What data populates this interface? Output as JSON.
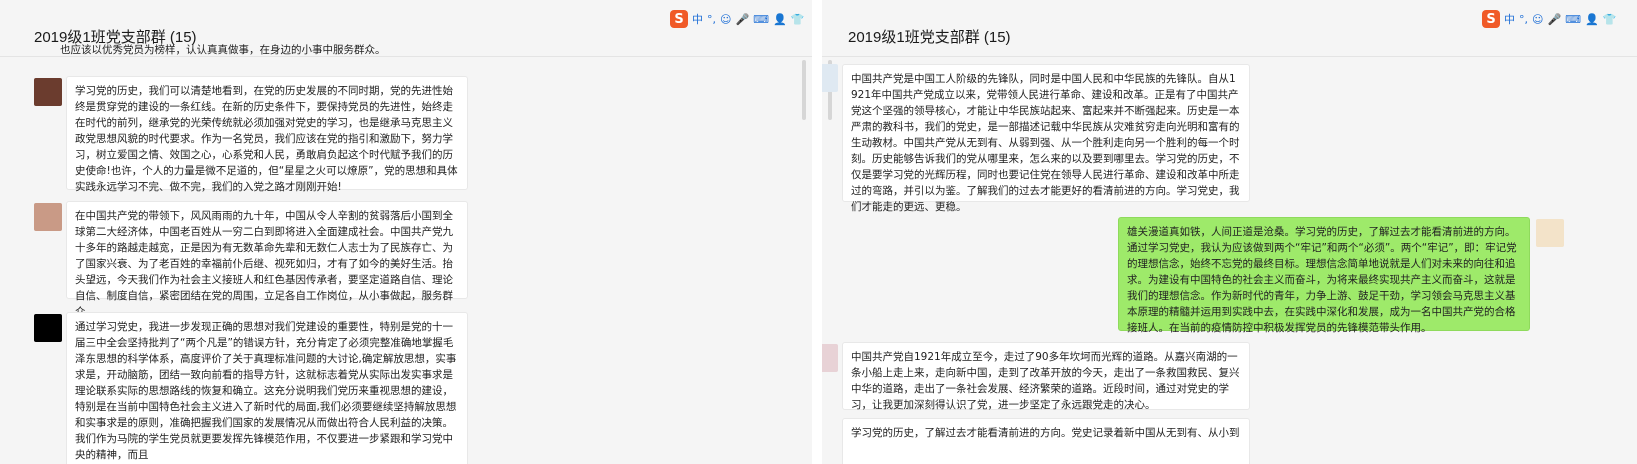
{
  "left": {
    "title": "2019级1班党支部群 (15)",
    "ime": {
      "logo": "S",
      "lang": "中",
      "punct": "°,"
    },
    "cut_text": "也应该以优秀党员为榜样，认认真真做事，在身边的小事中服务群众。",
    "messages": [
      {
        "text": "学习党的历史，我们可以清楚地看到，在党的历史发展的不同时期，党的先进性始终是贯穿党的建设的一条红线。在新的历史条件下，要保持党员的先进性，始终走在时代的前列，继承党的光荣传统就必须加强对党史的学习，也是继承马克思主义政党思想风貌的时代要求。作为一名党员，我们应该在党的指引和激励下，努力学习，树立爱国之情、效国之心，心系党和人民，勇敢肩负起这个时代赋予我们的历史使命!也许，个人的力量是微不足道的，但“星星之火可以燎原”，党的思想和具体实践永远学习不完、做不完，我们的入党之路才刚刚开始!"
      },
      {
        "text": "在中国共产党的带领下，风风雨雨的九十年，中国从令人辛割的贫弱落后小国到全球第二大经济体，中国老百姓从一穷二白到即将进入全面建成社会。中国共产党九十多年的路越走越宽，正是因为有无数革命先辈和无数仁人志士为了民族存亡、为了国家兴衰、为了老百姓的幸福前仆后继、视死如归，才有了如今的美好生活。抬头望远，今天我们作为社会主义接班人和红色基因传承者，要坚定道路自信、理论自信、制度自信，紧密团结在党的周围，立足各自工作岗位，从小事做起，服务群众。"
      },
      {
        "text": "通过学习党史，我进一步发现正确的思想对我们党建设的重要性，特别是党的十一届三中全会坚持批判了“两个凡是”的错误方针，充分肯定了必须完整准确地掌握毛泽东思想的科学体系，高度评价了关于真理标准问题的大讨论,确定解放思想，实事求是，开动脑筋，团结一致向前看的指导方针，这就标志着党从实际出发实事求是理论联系实际的思想路线的恢复和确立。这充分说明我们党历来重视思想的建设，特别是在当前中国特色社会主义进入了新时代的局面,我们必须要继续坚持解放思想和实事求是的原则，准确把握我们国家的发展情况从而做出符合人民利益的决策。我们作为马院的学生党员就更要发挥先锋模范作用，不仅要进一步紧跟和学习党中央的精神，而且"
      }
    ]
  },
  "right": {
    "title": "2019级1班党支部群 (15)",
    "ime": {
      "logo": "S",
      "lang": "中",
      "punct": "°,"
    },
    "messages": [
      {
        "text": "中国共产党是中国工人阶级的先锋队，同时是中国人民和中华民族的先锋队。自从1921年中国共产党成立以来，党带领人民进行革命、建设和改革。正是有了中国共产党这个坚强的领导核心，才能让中华民族站起来、富起来并不断强起来。历史是一本严肃的教科书，我们的党史，是一部描述记载中华民族从灾难贫穷走向光明和富有的生动教材。中国共产党从无到有、从弱到强、从一个胜利走向另一个胜利的每一个时刻。历史能够告诉我们的党从哪里来，怎么来的以及要到哪里去。学习党的历史，不仅是要学习党的光辉历程，同时也要记住党在领导人民进行革命、建设和改革中所走过的弯路，并引以为鉴。了解我们的过去才能更好的看清前进的方向。学习党史，我们才能走的更远、更稳。"
      },
      {
        "text": "雄关漫道真如铁，人间正道是沧桑。学习党的历史，了解过去才能看清前进的方向。通过学习党史，我认为应该做到两个“牢记”和两个“必须”。两个“牢记”，即：牢记党的理想信念，始终不忘党的最终目标。理想信念简单地说就是人们对未来的向往和追求。为建设有中国特色的社会主义而奋斗，为将来最终实现共产主义而奋斗，这就是我们的理想信念。作为新时代的青年，力争上游、鼓足干劲，学习领会马克思主义基本原理的精髓并运用到实践中去，在实践中深化和发展，成为一名中国共产党的合格接班人。在当前的疫情防控中积极发挥党员的先锋模范带头作用。"
      },
      {
        "text": "中国共产党自1921年成立至今，走过了90多年坎坷而光辉的道路。从嘉兴南湖的一条小船上走上来，走向新中国，走到了改革开放的今天，走出了一条救国救民、复兴中华的道路，走出了一条社会发展、经济繁荣的道路。近段时间，通过对党史的学习，让我更加深刻得认识了党，进一步坚定了永远跟党走的决心。"
      },
      {
        "text": "学习党的历史，了解过去才能看清前进的方向。党史记录着新中国从无到有、从小到"
      }
    ]
  },
  "colors": {
    "bubble_green": "#9eea6a",
    "pane_bg": "#f5f5f5",
    "ime_logo": "#f05a28"
  }
}
